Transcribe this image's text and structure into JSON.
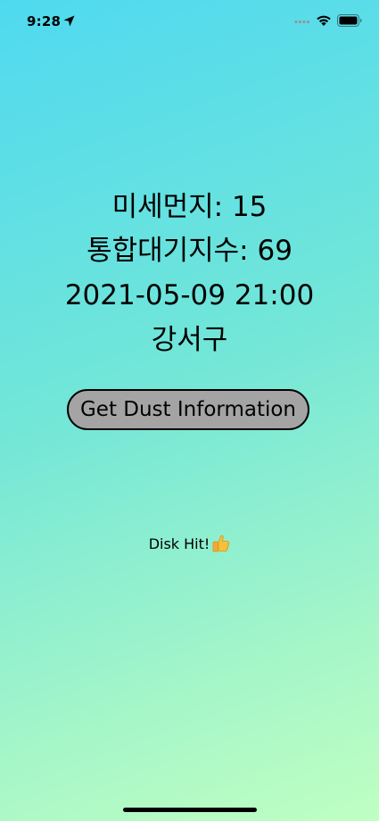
{
  "status_bar": {
    "time": "9:28",
    "icons": [
      "location-arrow-icon",
      "signal-icon",
      "wifi-icon",
      "battery-icon"
    ]
  },
  "dust": {
    "fine_dust": "미세먼지: 15",
    "air_quality_index": "통합대기지수: 69",
    "datetime": "2021-05-09 21:00",
    "district": "강서구"
  },
  "actions": {
    "get_button_label": "Get Dust Information"
  },
  "cache_status": {
    "label": "Disk Hit!",
    "icon": "thumbs-up-icon"
  },
  "colors": {
    "gradient_top": "#4fd9f0",
    "gradient_bottom": "#bfffc2",
    "button_fill": "#a4a4a4"
  }
}
